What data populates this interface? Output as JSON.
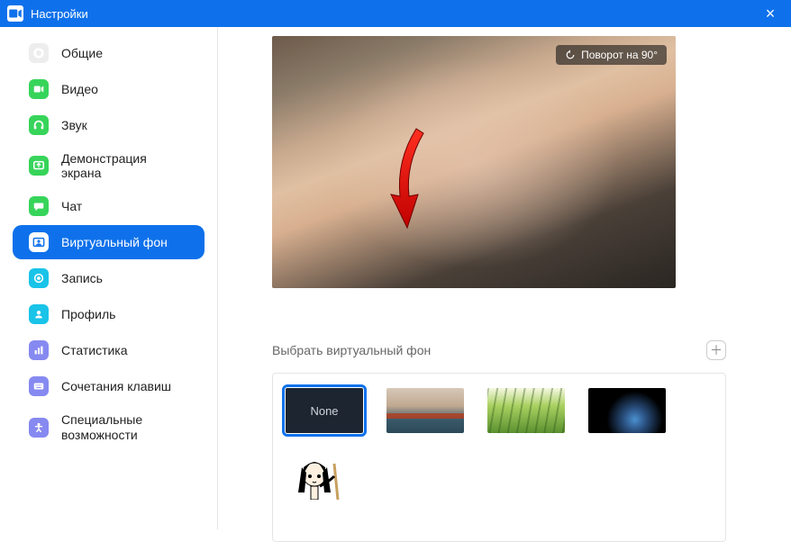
{
  "titlebar": {
    "title": "Настройки"
  },
  "sidebar": {
    "items": [
      {
        "label": "Общие"
      },
      {
        "label": "Видео"
      },
      {
        "label": "Звук"
      },
      {
        "label": "Демонстрация экрана"
      },
      {
        "label": "Чат"
      },
      {
        "label": "Виртуальный фон"
      },
      {
        "label": "Запись"
      },
      {
        "label": "Профиль"
      },
      {
        "label": "Статистика"
      },
      {
        "label": "Сочетания клавиш"
      },
      {
        "label": "Специальные возможности"
      }
    ]
  },
  "preview": {
    "rotate_label": "Поворот на 90°"
  },
  "section": {
    "title": "Выбрать виртуальный фон"
  },
  "thumbs": {
    "none_label": "None"
  }
}
